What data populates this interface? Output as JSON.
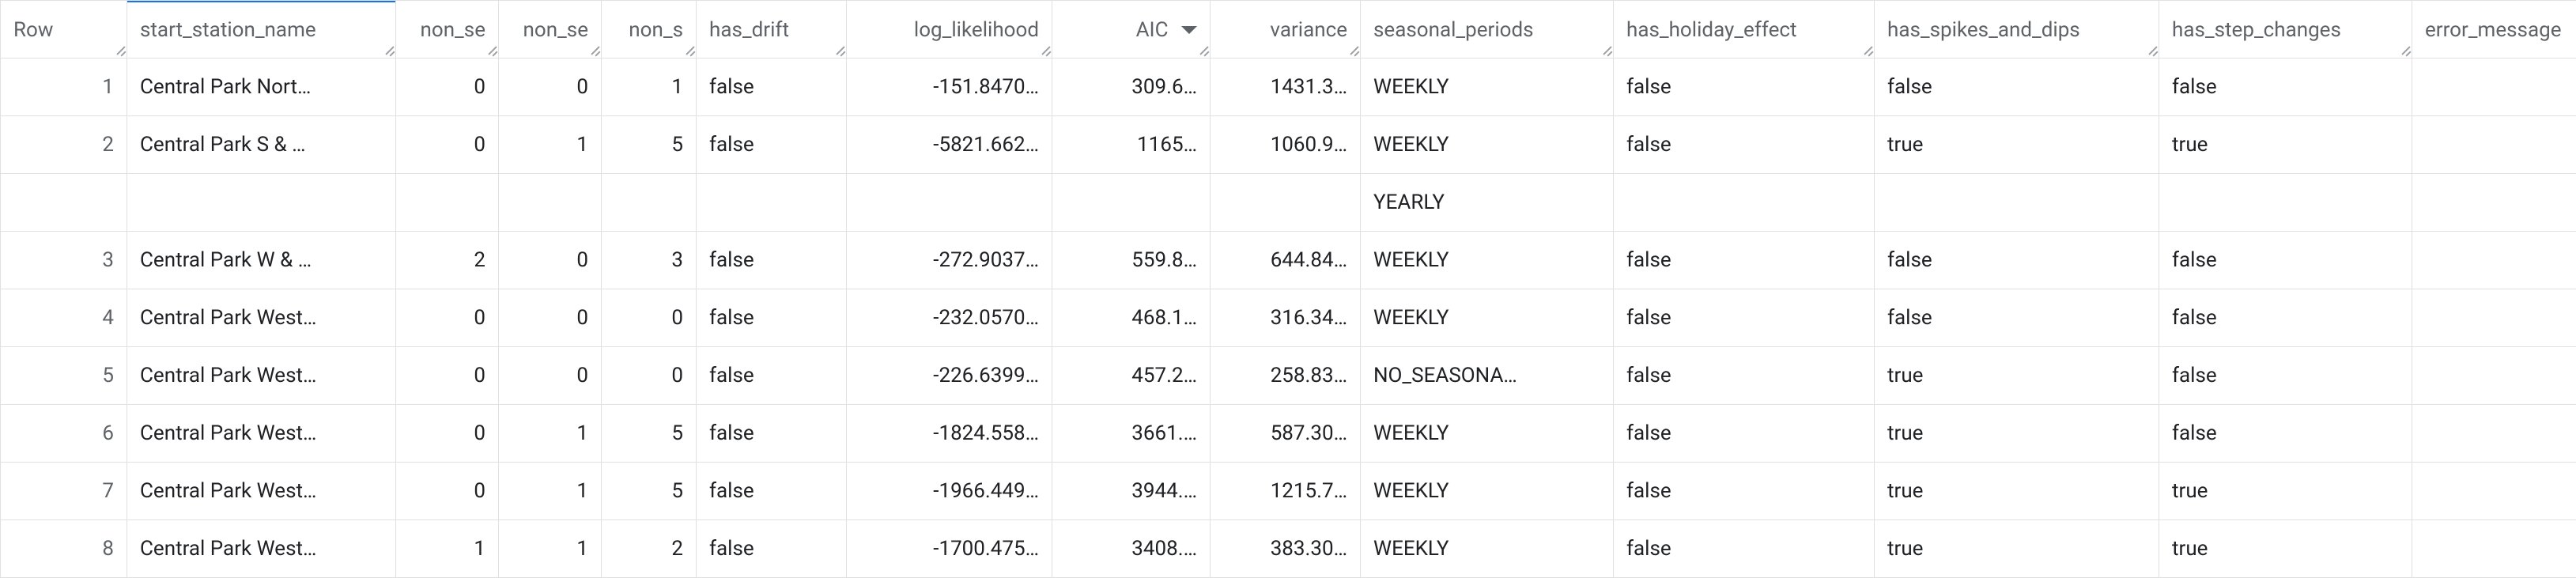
{
  "columns": {
    "row": "Row",
    "start_station_name": "start_station_name",
    "non_s1": "non_se",
    "non_s2": "non_se",
    "non_s3": "non_s",
    "has_drift": "has_drift",
    "log_likelihood": "log_likelihood",
    "aic": "AIC",
    "variance": "variance",
    "seasonal_periods": "seasonal_periods",
    "has_holiday_effect": "has_holiday_effect",
    "has_spikes_and_dips": "has_spikes_and_dips",
    "has_step_changes": "has_step_changes",
    "error_message": "error_message"
  },
  "rows": [
    {
      "row": "1",
      "start_station_name": "Central Park Nort…",
      "non_s1": "0",
      "non_s2": "0",
      "non_s3": "1",
      "has_drift": "false",
      "log_likelihood": "-151.8470…",
      "aic": "309.6…",
      "variance": "1431.3…",
      "seasonal_periods": "WEEKLY",
      "sub_seasonal": [],
      "has_holiday_effect": "false",
      "has_spikes_and_dips": "false",
      "has_step_changes": "false",
      "error_message": ""
    },
    {
      "row": "2",
      "start_station_name": "Central Park S & …",
      "non_s1": "0",
      "non_s2": "1",
      "non_s3": "5",
      "has_drift": "false",
      "log_likelihood": "-5821.662…",
      "aic": "1165…",
      "variance": "1060.9…",
      "seasonal_periods": "WEEKLY",
      "sub_seasonal": [
        "YEARLY"
      ],
      "has_holiday_effect": "false",
      "has_spikes_and_dips": "true",
      "has_step_changes": "true",
      "error_message": ""
    },
    {
      "row": "3",
      "start_station_name": "Central Park W & …",
      "non_s1": "2",
      "non_s2": "0",
      "non_s3": "3",
      "has_drift": "false",
      "log_likelihood": "-272.9037…",
      "aic": "559.8…",
      "variance": "644.84…",
      "seasonal_periods": "WEEKLY",
      "sub_seasonal": [],
      "has_holiday_effect": "false",
      "has_spikes_and_dips": "false",
      "has_step_changes": "false",
      "error_message": ""
    },
    {
      "row": "4",
      "start_station_name": "Central Park West…",
      "non_s1": "0",
      "non_s2": "0",
      "non_s3": "0",
      "has_drift": "false",
      "log_likelihood": "-232.0570…",
      "aic": "468.1…",
      "variance": "316.34…",
      "seasonal_periods": "WEEKLY",
      "sub_seasonal": [],
      "has_holiday_effect": "false",
      "has_spikes_and_dips": "false",
      "has_step_changes": "false",
      "error_message": ""
    },
    {
      "row": "5",
      "start_station_name": "Central Park West…",
      "non_s1": "0",
      "non_s2": "0",
      "non_s3": "0",
      "has_drift": "false",
      "log_likelihood": "-226.6399…",
      "aic": "457.2…",
      "variance": "258.83…",
      "seasonal_periods": "NO_SEASONA…",
      "sub_seasonal": [],
      "has_holiday_effect": "false",
      "has_spikes_and_dips": "true",
      "has_step_changes": "false",
      "error_message": ""
    },
    {
      "row": "6",
      "start_station_name": "Central Park West…",
      "non_s1": "0",
      "non_s2": "1",
      "non_s3": "5",
      "has_drift": "false",
      "log_likelihood": "-1824.558…",
      "aic": "3661.…",
      "variance": "587.30…",
      "seasonal_periods": "WEEKLY",
      "sub_seasonal": [],
      "has_holiday_effect": "false",
      "has_spikes_and_dips": "true",
      "has_step_changes": "false",
      "error_message": ""
    },
    {
      "row": "7",
      "start_station_name": "Central Park West…",
      "non_s1": "0",
      "non_s2": "1",
      "non_s3": "5",
      "has_drift": "false",
      "log_likelihood": "-1966.449…",
      "aic": "3944.…",
      "variance": "1215.7…",
      "seasonal_periods": "WEEKLY",
      "sub_seasonal": [],
      "has_holiday_effect": "false",
      "has_spikes_and_dips": "true",
      "has_step_changes": "true",
      "error_message": ""
    },
    {
      "row": "8",
      "start_station_name": "Central Park West…",
      "non_s1": "1",
      "non_s2": "1",
      "non_s3": "2",
      "has_drift": "false",
      "log_likelihood": "-1700.475…",
      "aic": "3408.…",
      "variance": "383.30…",
      "seasonal_periods": "WEEKLY",
      "sub_seasonal": [],
      "has_holiday_effect": "false",
      "has_spikes_and_dips": "true",
      "has_step_changes": "true",
      "error_message": ""
    }
  ]
}
